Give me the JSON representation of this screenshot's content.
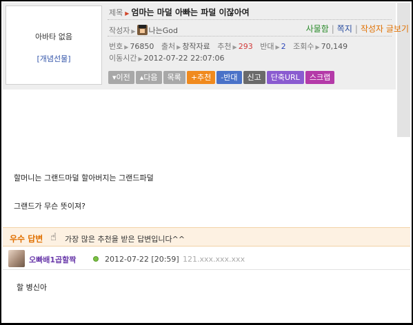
{
  "post": {
    "title_label": "제목",
    "title": "엄마는 마덜 아빠는 파덜 이잖아여",
    "author_label": "작성자",
    "author_name": "나는God",
    "links": [
      "사물함",
      "쪽지",
      "작성자 글보기"
    ],
    "meta": {
      "num_label": "번호",
      "num_value": "76850",
      "source_label": "출처",
      "source_value": "창작자료",
      "rec_label": "추천",
      "rec_value": "293",
      "opp_label": "반대",
      "opp_value": "2",
      "views_label": "조회수",
      "views_value": "70,149",
      "moved_label": "이동시간",
      "moved_value": "2012-07-22 22:07:06"
    },
    "buttons": {
      "prev": "이전",
      "next": "다음",
      "list": "목록",
      "recommend": "+추천",
      "oppose": "-반대",
      "report": "신고",
      "short_url": "단축URL",
      "scrap": "스크랩"
    },
    "body_lines": [
      "할머니는 그랜드마덜 할아버지는 그랜드파덜",
      "그랜드가 무슨 뜻이져?"
    ]
  },
  "sidebar": {
    "no_avatar": "아바타 없음",
    "gift_link": "[개념선물]"
  },
  "best_answer": {
    "label": "우수 답변",
    "description": "가장 많은 추천을 받은 답변입니다^^"
  },
  "reply": {
    "name": "오빠배1곱할짝",
    "time": "2012-07-22 [20:59]",
    "ip": "121.xxx.xxx.xxx",
    "body": "할 병신아"
  },
  "colors": {
    "accent_orange": "#e07000",
    "recommend_red": "#d23a3a",
    "opp_blue": "#2d47b8",
    "reply_name_purple": "#6a3aaa"
  }
}
